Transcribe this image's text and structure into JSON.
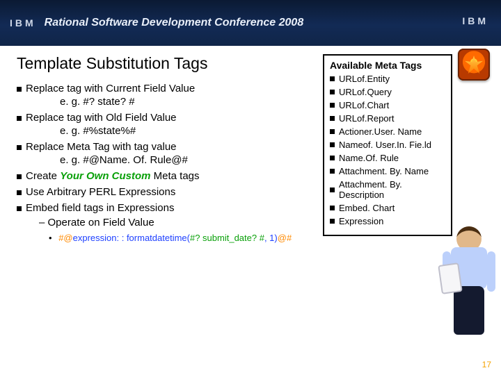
{
  "header": {
    "brand": "IBM",
    "title": "Rational Software Development Conference 2008",
    "brand_right": "IBM"
  },
  "slide": {
    "title": "Template Substitution Tags",
    "bullets": [
      {
        "text": "Replace tag with Current Field Value",
        "sub": "e. g. #? state? #"
      },
      {
        "text": "Replace tag with Old Field Value",
        "sub": "e. g. #%state%#"
      },
      {
        "text": "Replace Meta Tag with tag value",
        "sub": "e. g. #@Name. Of. Rule@#"
      }
    ],
    "create_custom_pre": "Create ",
    "create_custom_emph": "Your Own Custom",
    "create_custom_post": " Meta tags",
    "use_perl": "Use Arbitrary PERL Expressions",
    "embed_expr": "Embed field tags in Expressions",
    "operate": "– Operate on Field Value",
    "expr_example": {
      "seg1": "#@",
      "seg2": "expression: : formatdatetime(",
      "seg3": "#? submit_date? #",
      "seg4": ", 1)",
      "seg5": "@#"
    }
  },
  "meta_box": {
    "title": "Available Meta Tags",
    "items": [
      "URLof.Entity",
      "URLof.Query",
      "URLof.Chart",
      "URLof.Report",
      "Actioner.User. Name",
      "Nameof. User.In. Fie.ld",
      "Name.Of. Rule",
      "Attachment. By. Name",
      "Attachment. By. Description",
      "Embed. Chart",
      "Expression"
    ]
  },
  "page_number": "17"
}
